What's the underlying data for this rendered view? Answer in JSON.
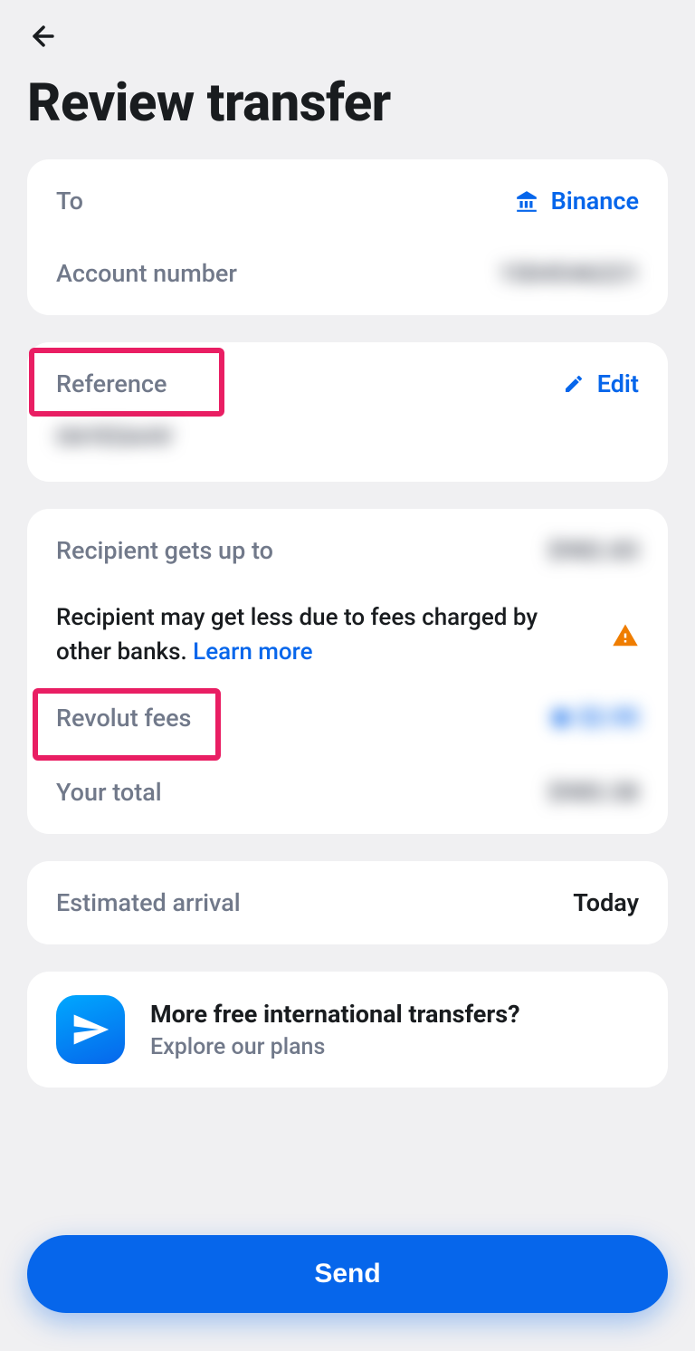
{
  "header": {
    "title": "Review transfer"
  },
  "recipient": {
    "to_label": "To",
    "to_value": "Binance",
    "account_label": "Account number",
    "account_value": "1504546221"
  },
  "reference": {
    "label": "Reference",
    "edit_label": "Edit",
    "value": "O6YESA4V"
  },
  "amounts": {
    "gets_label": "Recipient gets up to",
    "gets_value": "$982.83",
    "disclaimer": "Recipient may get less due to fees charged by other banks. ",
    "learn_more": "Learn more",
    "fees_label": "Revolut fees",
    "fees_value": "$2.95",
    "total_label": "Your total",
    "total_value": "$985.58"
  },
  "arrival": {
    "label": "Estimated arrival",
    "value": "Today"
  },
  "promo": {
    "title": "More free international transfers?",
    "subtitle": "Explore our plans"
  },
  "actions": {
    "send_label": "Send"
  }
}
